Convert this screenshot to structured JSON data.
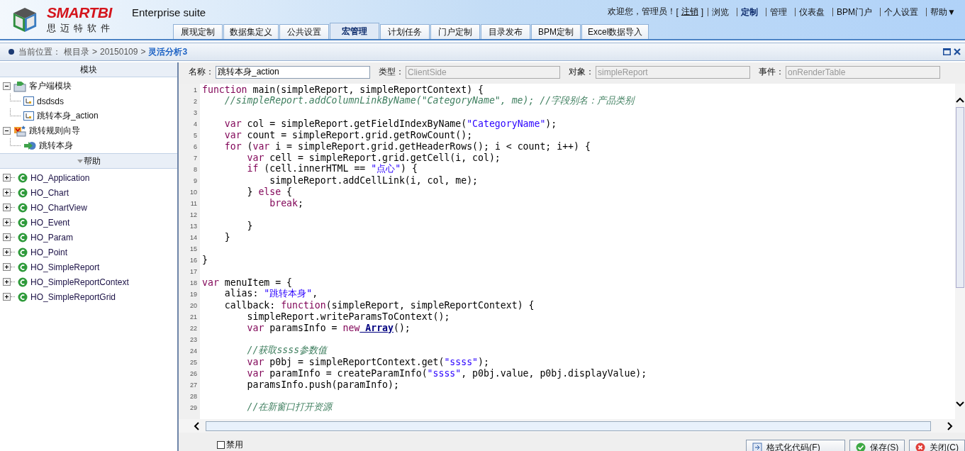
{
  "brand": {
    "name": "SMARTBI",
    "subtitle": "思迈特软件",
    "product": "Enterprise suite"
  },
  "user_bar": {
    "greeting": "欢迎您，管理员！",
    "open_bracket": "[",
    "logout": "注销",
    "close_bracket": "]",
    "links": [
      {
        "label": "浏览",
        "selected": false
      },
      {
        "label": "定制",
        "selected": true
      },
      {
        "label": "管理",
        "selected": false
      },
      {
        "label": "仪表盘",
        "selected": false
      },
      {
        "label": "BPM门户",
        "selected": false
      },
      {
        "label": "个人设置",
        "selected": false
      },
      {
        "label": "帮助▼",
        "selected": false
      }
    ]
  },
  "tabs": [
    {
      "label": "展现定制",
      "selected": false
    },
    {
      "label": "数据集定义",
      "selected": false
    },
    {
      "label": "公共设置",
      "selected": false
    },
    {
      "label": "宏管理",
      "selected": true
    },
    {
      "label": "计划任务",
      "selected": false
    },
    {
      "label": "门户定制",
      "selected": false
    },
    {
      "label": "目录发布",
      "selected": false
    },
    {
      "label": "BPM定制",
      "selected": false
    },
    {
      "label": "Excel数据导入",
      "selected": false
    }
  ],
  "breadcrumb": {
    "prefix": "当前位置：",
    "separator": ">",
    "path": [
      "根目录",
      "20150109"
    ],
    "current": "灵活分析3"
  },
  "module_panel": {
    "title": "模块",
    "tree": [
      {
        "label": "客户端模块",
        "kind": "module",
        "expanded": true,
        "children": [
          {
            "label": "dsdsds",
            "kind": "macro"
          },
          {
            "label": "跳转本身_action",
            "kind": "macro"
          }
        ]
      },
      {
        "label": "跳转规则向导",
        "kind": "wizard",
        "expanded": true,
        "children": [
          {
            "label": "跳转本身",
            "kind": "action"
          }
        ]
      }
    ]
  },
  "help_panel": {
    "title": "帮助",
    "items": [
      {
        "label": "HO_Application",
        "expanded": false
      },
      {
        "label": "HO_Chart",
        "expanded": false
      },
      {
        "label": "HO_ChartView",
        "expanded": false
      },
      {
        "label": "HO_Event",
        "expanded": false
      },
      {
        "label": "HO_Param",
        "expanded": false
      },
      {
        "label": "HO_Point",
        "expanded": false
      },
      {
        "label": "HO_SimpleReport",
        "expanded": false
      },
      {
        "label": "HO_SimpleReportContext",
        "expanded": false
      },
      {
        "label": "HO_SimpleReportGrid",
        "expanded": false
      }
    ]
  },
  "form": [
    {
      "label": "名称：",
      "value": "跳转本身_action",
      "disabled": false
    },
    {
      "label": "类型：",
      "value": "ClientSide",
      "disabled": true
    },
    {
      "label": "对象：",
      "value": "simpleReport",
      "disabled": true
    },
    {
      "label": "事件：",
      "value": "onRenderTable",
      "disabled": true
    }
  ],
  "code": [
    {
      "n": "1",
      "tokens": [
        {
          "kind": "keyword",
          "text": "function"
        },
        {
          "kind": "plain",
          "text": " main(simpleReport, simpleReportContext) {"
        }
      ]
    },
    {
      "n": "2",
      "tokens": [
        {
          "kind": "comment",
          "text": "    //simpleReport.addColumnLinkByName(\"CategoryName\", me); //字段别名：产品类别"
        }
      ]
    },
    {
      "n": "3"
    },
    {
      "n": "4",
      "tokens": [
        {
          "kind": "keyword",
          "text": "    var"
        },
        {
          "kind": "plain",
          "text": " col = simpleReport.getFieldIndexByName("
        },
        {
          "kind": "string",
          "text": "\"CategoryName\""
        },
        {
          "kind": "plain",
          "text": ");"
        }
      ]
    },
    {
      "n": "5",
      "tokens": [
        {
          "kind": "keyword",
          "text": "    var"
        },
        {
          "kind": "plain",
          "text": " count = simpleReport.grid.getRowCount();"
        }
      ]
    },
    {
      "n": "6",
      "tokens": [
        {
          "kind": "keyword",
          "text": "    for"
        },
        {
          "kind": "plain",
          "text": " ("
        },
        {
          "kind": "keyword",
          "text": "var"
        },
        {
          "kind": "plain",
          "text": " i = simpleReport.grid.getHeaderRows(); i < count; i++) {"
        }
      ]
    },
    {
      "n": "7",
      "tokens": [
        {
          "kind": "keyword",
          "text": "        var"
        },
        {
          "kind": "plain",
          "text": " cell = simpleReport.grid.getCell(i, col);"
        }
      ]
    },
    {
      "n": "8",
      "tokens": [
        {
          "kind": "keyword",
          "text": "        if"
        },
        {
          "kind": "plain",
          "text": " (cell.innerHTML == "
        },
        {
          "kind": "string",
          "text": "\"点心\""
        },
        {
          "kind": "plain",
          "text": ") {"
        }
      ]
    },
    {
      "n": "9",
      "tokens": [
        {
          "kind": "plain",
          "text": "            simpleReport.addCellLink(i, col, me);"
        }
      ]
    },
    {
      "n": "10",
      "tokens": [
        {
          "kind": "plain",
          "text": "        } "
        },
        {
          "kind": "keyword",
          "text": "else"
        },
        {
          "kind": "plain",
          "text": " {"
        }
      ]
    },
    {
      "n": "11",
      "tokens": [
        {
          "kind": "keyword",
          "text": "            break"
        },
        {
          "kind": "plain",
          "text": ";"
        }
      ]
    },
    {
      "n": "12"
    },
    {
      "n": "13",
      "tokens": [
        {
          "kind": "plain",
          "text": "        }"
        }
      ]
    },
    {
      "n": "14",
      "tokens": [
        {
          "kind": "plain",
          "text": "    }"
        }
      ]
    },
    {
      "n": "15"
    },
    {
      "n": "16",
      "tokens": [
        {
          "kind": "plain",
          "text": "}"
        }
      ]
    },
    {
      "n": "17"
    },
    {
      "n": "18",
      "tokens": [
        {
          "kind": "keyword",
          "text": "var"
        },
        {
          "kind": "plain",
          "text": " menuItem = {"
        }
      ]
    },
    {
      "n": "19",
      "tokens": [
        {
          "kind": "plain",
          "text": "    alias: "
        },
        {
          "kind": "string",
          "text": "\"跳转本身\""
        },
        {
          "kind": "plain",
          "text": ","
        }
      ]
    },
    {
      "n": "20",
      "tokens": [
        {
          "kind": "plain",
          "text": "    callback: "
        },
        {
          "kind": "keyword",
          "text": "function"
        },
        {
          "kind": "plain",
          "text": "(simpleReport, simpleReportContext) {"
        }
      ]
    },
    {
      "n": "21",
      "tokens": [
        {
          "kind": "plain",
          "text": "        simpleReport.writeParamsToContext();"
        }
      ]
    },
    {
      "n": "22",
      "tokens": [
        {
          "kind": "keyword",
          "text": "        var"
        },
        {
          "kind": "plain",
          "text": " paramsInfo = "
        },
        {
          "kind": "keyword",
          "text": "new"
        },
        {
          "kind": "link",
          "text": " Array"
        },
        {
          "kind": "plain",
          "text": "();"
        }
      ]
    },
    {
      "n": "23"
    },
    {
      "n": "24",
      "tokens": [
        {
          "kind": "comment",
          "text": "        //获取ssss参数值"
        }
      ]
    },
    {
      "n": "25",
      "tokens": [
        {
          "kind": "keyword",
          "text": "        var"
        },
        {
          "kind": "plain",
          "text": " p0bj = simpleReportContext.get("
        },
        {
          "kind": "string",
          "text": "\"ssss\""
        },
        {
          "kind": "plain",
          "text": ");"
        }
      ]
    },
    {
      "n": "26",
      "tokens": [
        {
          "kind": "keyword",
          "text": "        var"
        },
        {
          "kind": "plain",
          "text": " paramInfo = createParamInfo("
        },
        {
          "kind": "string",
          "text": "\"ssss\""
        },
        {
          "kind": "plain",
          "text": ", p0bj.value, p0bj.displayValue);"
        }
      ]
    },
    {
      "n": "27",
      "tokens": [
        {
          "kind": "plain",
          "text": "        paramsInfo.push(paramInfo);"
        }
      ]
    },
    {
      "n": "28"
    },
    {
      "n": "29",
      "tokens": [
        {
          "kind": "comment",
          "text": "        //在新窗口打开资源"
        }
      ]
    }
  ],
  "disable_checkbox": {
    "label": "禁用",
    "checked": false
  },
  "buttons": [
    {
      "label": "格式化代码(F)",
      "kind": "format"
    },
    {
      "label": "保存(S)",
      "kind": "save"
    },
    {
      "label": "关闭(C)",
      "kind": "close"
    }
  ]
}
